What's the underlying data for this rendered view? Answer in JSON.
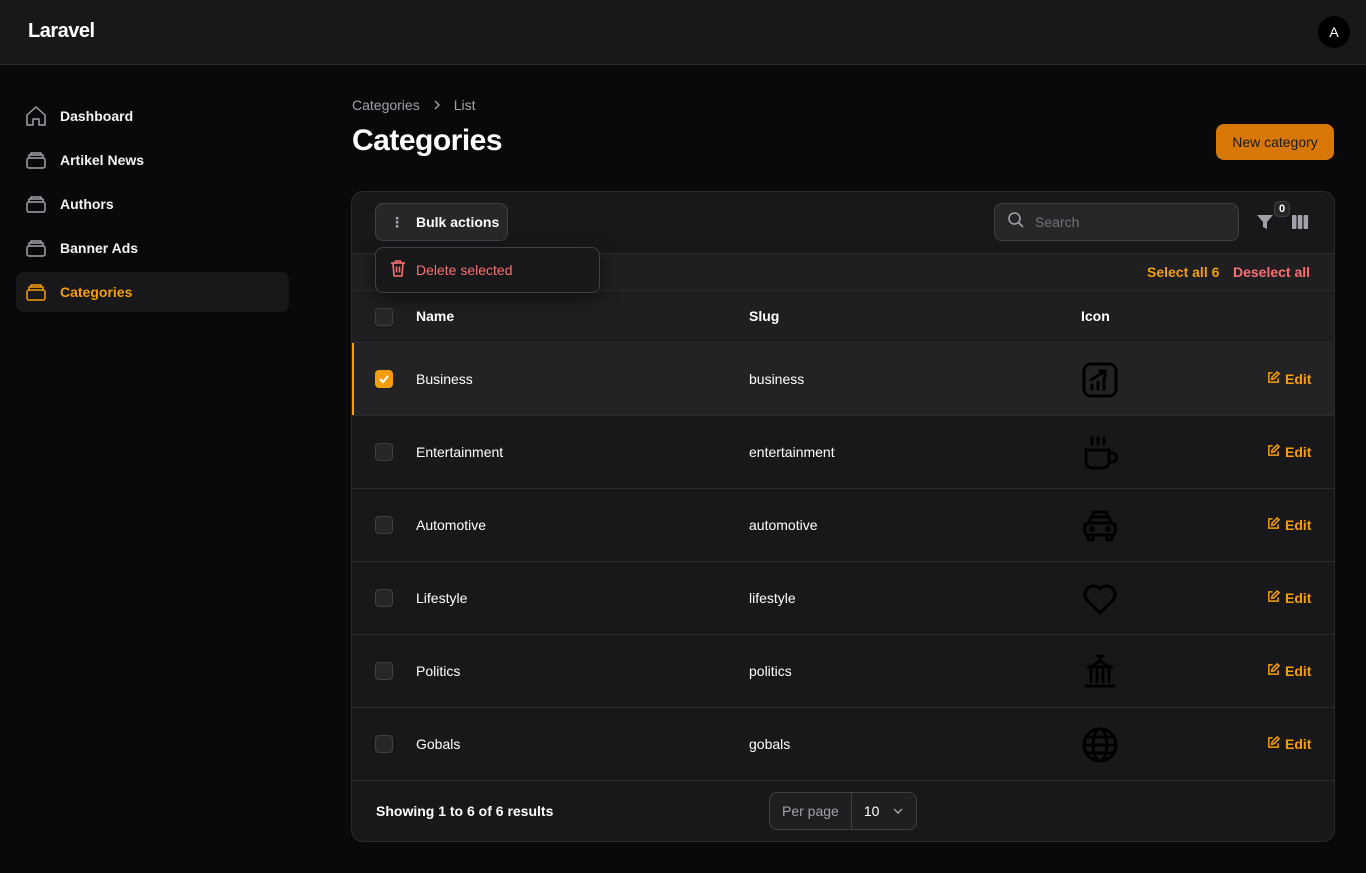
{
  "app": {
    "brand": "Laravel",
    "avatar_initial": "A"
  },
  "sidebar": {
    "items": [
      {
        "label": "Dashboard",
        "icon": "home-icon",
        "active": false
      },
      {
        "label": "Artikel News",
        "icon": "stack-icon",
        "active": false
      },
      {
        "label": "Authors",
        "icon": "stack-icon",
        "active": false
      },
      {
        "label": "Banner Ads",
        "icon": "stack-icon",
        "active": false
      },
      {
        "label": "Categories",
        "icon": "stack-icon",
        "active": true
      }
    ]
  },
  "breadcrumb": {
    "items": [
      "Categories",
      "List"
    ]
  },
  "page": {
    "title": "Categories",
    "new_button": "New category"
  },
  "toolbar": {
    "bulk_actions": "Bulk actions",
    "search_placeholder": "Search",
    "filter_count": "0"
  },
  "bulk_menu": {
    "delete_selected": "Delete selected"
  },
  "selection": {
    "select_all": "Select all 6",
    "deselect_all": "Deselect all"
  },
  "table": {
    "columns": [
      "Name",
      "Slug",
      "Icon"
    ],
    "rows": [
      {
        "name": "Business",
        "slug": "business",
        "icon": "chart-trend-icon",
        "checked": true,
        "action": "Edit"
      },
      {
        "name": "Entertainment",
        "slug": "entertainment",
        "icon": "mug-icon",
        "checked": false,
        "action": "Edit"
      },
      {
        "name": "Automotive",
        "slug": "automotive",
        "icon": "car-icon",
        "checked": false,
        "action": "Edit"
      },
      {
        "name": "Lifestyle",
        "slug": "lifestyle",
        "icon": "heart-icon",
        "checked": false,
        "action": "Edit"
      },
      {
        "name": "Politics",
        "slug": "politics",
        "icon": "building-icon",
        "checked": false,
        "action": "Edit"
      },
      {
        "name": "Gobals",
        "slug": "gobals",
        "icon": "globe-icon",
        "checked": false,
        "action": "Edit"
      }
    ]
  },
  "footer": {
    "showing": "Showing 1 to 6 of 6 results",
    "per_page_label": "Per page",
    "per_page_value": "10"
  },
  "colors": {
    "accent": "#f59e0b",
    "danger": "#f87171",
    "background": "#09090b",
    "surface": "#18181b"
  }
}
